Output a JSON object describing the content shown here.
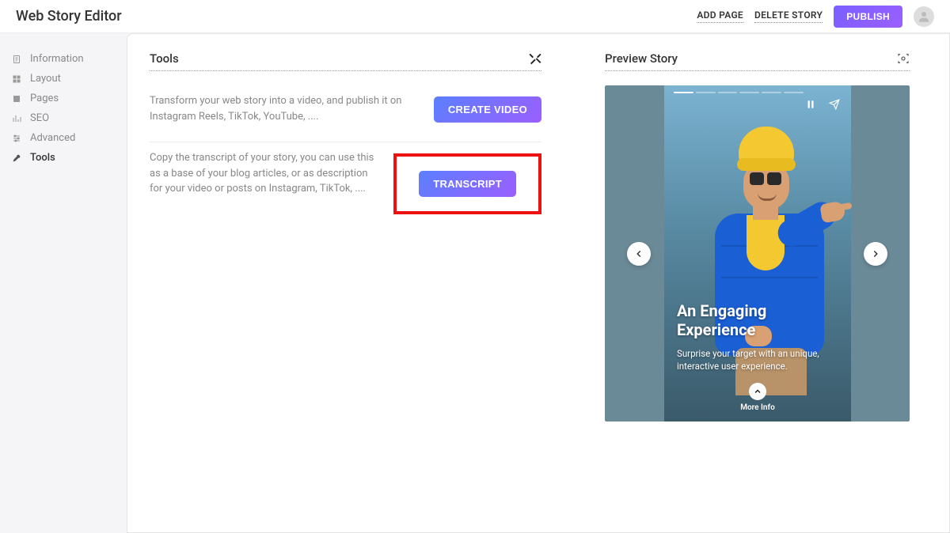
{
  "header": {
    "title": "Web Story Editor",
    "addPage": "ADD PAGE",
    "deleteStory": "DELETE STORY",
    "publish": "PUBLISH"
  },
  "sidebar": {
    "items": [
      {
        "label": "Information",
        "icon": "doc-icon"
      },
      {
        "label": "Layout",
        "icon": "layout-icon"
      },
      {
        "label": "Pages",
        "icon": "pages-icon"
      },
      {
        "label": "SEO",
        "icon": "chart-icon"
      },
      {
        "label": "Advanced",
        "icon": "sliders-icon"
      },
      {
        "label": "Tools",
        "icon": "tools-icon"
      }
    ],
    "activeIndex": 5
  },
  "tools": {
    "title": "Tools",
    "items": [
      {
        "desc": "Transform your web story into a video, and publish it on Instagram Reels, TikTok, YouTube, ....",
        "button": "CREATE VIDEO",
        "highlight": false
      },
      {
        "desc": "Copy the transcript of your story, you can use this as a base of your blog articles, or as description for your video or posts on Instagram, TikTok, ....",
        "button": "TRANSCRIPT",
        "highlight": true
      }
    ]
  },
  "preview": {
    "title": "Preview Story",
    "story": {
      "heading": "An Engaging Experience",
      "caption": "Surprise your target with an unique, interactive user experience.",
      "moreLabel": "More Info"
    }
  }
}
